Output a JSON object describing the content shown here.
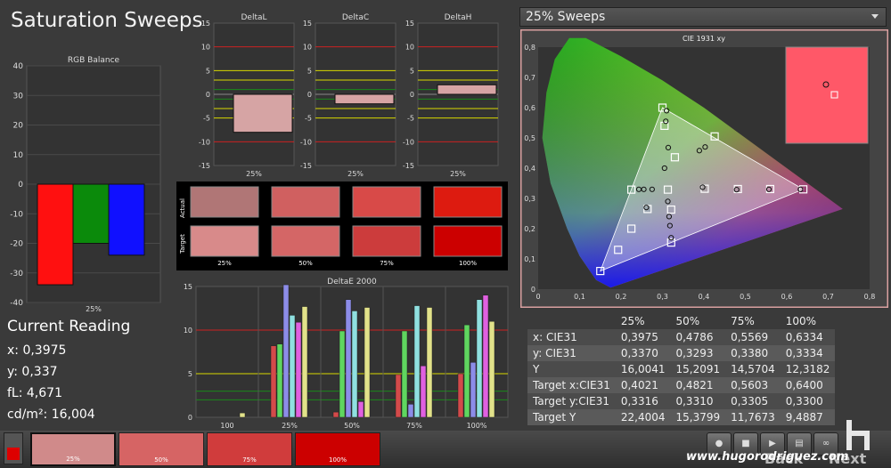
{
  "page_title": "Saturation Sweeps",
  "sweep_select": {
    "value": "25% Sweeps"
  },
  "current_reading": {
    "title": "Current Reading",
    "x": "x: 0,3975",
    "y": "y: 0,337",
    "fl": "fL: 4,671",
    "cd": "cd/m²: 16,004"
  },
  "colors": {
    "accent_red": "#dd0000",
    "chart_bg": "#333333",
    "panel_border": "#d9a0a0"
  },
  "chart_data": [
    {
      "type": "bar",
      "title": "RGB Balance",
      "categories": [
        "25%"
      ],
      "series": [
        {
          "name": "R",
          "values": [
            -34
          ]
        },
        {
          "name": "G",
          "values": [
            -20
          ]
        },
        {
          "name": "B",
          "values": [
            -24
          ]
        }
      ],
      "ylim": [
        -40,
        40
      ],
      "yticks": [
        "40",
        "30",
        "20",
        "10",
        "0",
        "-10",
        "-20",
        "-30",
        "-40"
      ]
    },
    {
      "type": "bar",
      "title": "DeltaL",
      "categories": [
        "25%"
      ],
      "values": [
        -8
      ],
      "ylim": [
        -15,
        15
      ],
      "yticks": [
        "15",
        "10",
        "5",
        "0",
        "-5",
        "-10",
        "-15"
      ]
    },
    {
      "type": "bar",
      "title": "DeltaC",
      "categories": [
        "25%"
      ],
      "values": [
        -2
      ],
      "ylim": [
        -15,
        15
      ],
      "yticks": [
        "15",
        "10",
        "5",
        "0",
        "-5",
        "-10",
        "-15"
      ]
    },
    {
      "type": "bar",
      "title": "DeltaH",
      "categories": [
        "25%"
      ],
      "values": [
        2
      ],
      "ylim": [
        -15,
        15
      ],
      "yticks": [
        "15",
        "10",
        "5",
        "0",
        "-5",
        "-10",
        "-15"
      ]
    },
    {
      "type": "table",
      "title": "Actual / Target",
      "row_labels": [
        "Actual",
        "Target"
      ],
      "columns": [
        "25%",
        "50%",
        "75%",
        "100%"
      ],
      "actual_colors": [
        "#b07676",
        "#d06060",
        "#d84a48",
        "#dd1b10"
      ],
      "target_colors": [
        "#d88a8a",
        "#d46666",
        "#cc3c3c",
        "#cc0000"
      ]
    },
    {
      "type": "bar",
      "title": "DeltaE 2000",
      "categories": [
        "100",
        "25%",
        "50%",
        "75%",
        "100%"
      ],
      "ylim": [
        0,
        15
      ],
      "yticks": [
        "15",
        "10",
        "5",
        "0"
      ],
      "series": [
        {
          "name": "red",
          "values": [
            0,
            8.2,
            0.6,
            4.9,
            5.0
          ]
        },
        {
          "name": "green",
          "values": [
            0,
            8.4,
            9.9,
            9.9,
            10.6
          ]
        },
        {
          "name": "blue",
          "values": [
            0,
            15.2,
            13.5,
            1.5,
            6.3
          ]
        },
        {
          "name": "cyan",
          "values": [
            0,
            11.7,
            12.2,
            12.8,
            13.5
          ]
        },
        {
          "name": "magenta",
          "values": [
            0,
            10.9,
            1.8,
            5.9,
            14.0
          ]
        },
        {
          "name": "yellow",
          "values": [
            0.5,
            12.7,
            12.6,
            12.6,
            11.0
          ]
        }
      ]
    },
    {
      "type": "scatter",
      "title": "CIE 1931 xy",
      "xlim": [
        0,
        0.8
      ],
      "ylim": [
        0,
        0.8
      ],
      "xticks": [
        "0",
        "0,1",
        "0,2",
        "0,3",
        "0,4",
        "0,5",
        "0,6",
        "0,7",
        "0,8"
      ],
      "yticks": [
        "0,8",
        "0,7",
        "0,6",
        "0,5",
        "0,4",
        "0,3",
        "0,2",
        "0,1",
        "0"
      ],
      "gamut": [
        [
          0.64,
          0.33
        ],
        [
          0.3,
          0.6
        ],
        [
          0.15,
          0.06
        ]
      ],
      "targets": [
        [
          0.64,
          0.33
        ],
        [
          0.56,
          0.331
        ],
        [
          0.482,
          0.331
        ],
        [
          0.402,
          0.332
        ],
        [
          0.3,
          0.6
        ],
        [
          0.305,
          0.54
        ],
        [
          0.426,
          0.505
        ],
        [
          0.33,
          0.436
        ],
        [
          0.15,
          0.06
        ],
        [
          0.193,
          0.13
        ],
        [
          0.225,
          0.2
        ],
        [
          0.264,
          0.265
        ],
        [
          0.225,
          0.329
        ],
        [
          0.321,
          0.154
        ],
        [
          0.321,
          0.263
        ],
        [
          0.313,
          0.329
        ]
      ],
      "measured": [
        [
          0.633,
          0.33
        ],
        [
          0.557,
          0.33
        ],
        [
          0.479,
          0.329
        ],
        [
          0.397,
          0.337
        ],
        [
          0.31,
          0.59
        ],
        [
          0.308,
          0.555
        ],
        [
          0.403,
          0.47
        ],
        [
          0.389,
          0.458
        ],
        [
          0.314,
          0.468
        ],
        [
          0.305,
          0.4
        ],
        [
          0.261,
          0.27
        ],
        [
          0.243,
          0.33
        ],
        [
          0.255,
          0.33
        ],
        [
          0.275,
          0.33
        ],
        [
          0.313,
          0.29
        ],
        [
          0.316,
          0.24
        ],
        [
          0.318,
          0.21
        ],
        [
          0.321,
          0.17
        ]
      ],
      "inset_measured": [
        [
          0.8,
          0.68
        ]
      ],
      "inset_target": [
        [
          0.82,
          0.64
        ]
      ]
    }
  ],
  "data_table": {
    "header": [
      "",
      "25%",
      "50%",
      "75%",
      "100%"
    ],
    "rows": [
      [
        "x: CIE31",
        "0,3975",
        "0,4786",
        "0,5569",
        "0,6334"
      ],
      [
        "y: CIE31",
        "0,3370",
        "0,3293",
        "0,3380",
        "0,3334"
      ],
      [
        "Y",
        "16,0041",
        "15,2091",
        "14,5704",
        "12,3182"
      ],
      [
        "Target x:CIE31",
        "0,4021",
        "0,4821",
        "0,5603",
        "0,6400"
      ],
      [
        "Target y:CIE31",
        "0,3316",
        "0,3310",
        "0,3305",
        "0,3300"
      ],
      [
        "Target Y",
        "22,4004",
        "15,3799",
        "11,7673",
        "9,4887"
      ]
    ]
  },
  "swatches": [
    {
      "label": "25%",
      "color": "#d08a8a"
    },
    {
      "label": "50%",
      "color": "#d66464"
    },
    {
      "label": "75%",
      "color": "#d03c3c"
    },
    {
      "label": "100%",
      "color": "#cc0000"
    }
  ],
  "controls": {
    "record": "●",
    "stop": "■",
    "play": "▶",
    "save": "▤",
    "loop": "∞",
    "pause": "⏸"
  },
  "nav": {
    "back": "Back",
    "next": "Next"
  },
  "watermark": "www.hugorodriguez.com"
}
